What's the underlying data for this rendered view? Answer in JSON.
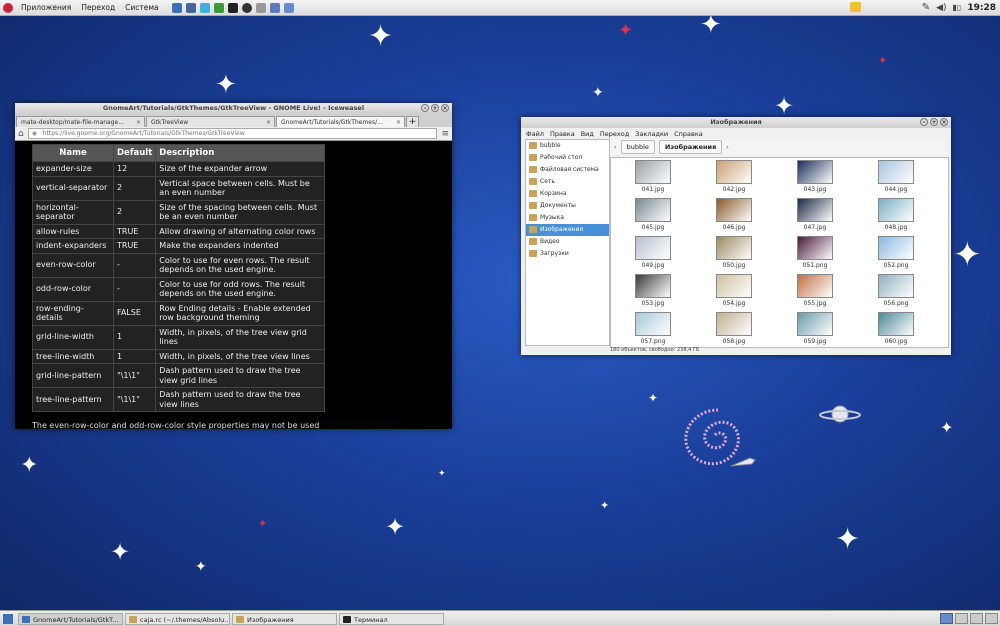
{
  "top_panel": {
    "menus": [
      "Приложения",
      "Переход",
      "Система"
    ],
    "clock": "19:28"
  },
  "browser": {
    "title": "GnomeArt/Tutorials/GtkThemes/GtkTreeView - GNOME Live! - Iceweasel",
    "tabs": [
      {
        "label": "mate-desktop/mate-file-manage..."
      },
      {
        "label": "GtkTreeView"
      },
      {
        "label": "GnomeArt/Tutorials/GtkThemes/..."
      }
    ],
    "url": "https://live.gnome.org/GnomeArt/Tutorials/GtkThemes/GtkTreeView",
    "table": {
      "headers": [
        "Name",
        "Default",
        "Description"
      ],
      "rows": [
        [
          "expander-size",
          "12",
          "Size of the expander arrow"
        ],
        [
          "vertical-separator",
          "2",
          "Vertical space between cells. Must be an even number"
        ],
        [
          "horizontal-separator",
          "2",
          "Size of the spacing between cells. Must be an even number"
        ],
        [
          "allow-rules",
          "TRUE",
          "Allow drawing of alternating color rows"
        ],
        [
          "indent-expanders",
          "TRUE",
          "Make the expanders indented"
        ],
        [
          "even-row-color",
          "-",
          "Color to use for even rows. The result depends on the used engine."
        ],
        [
          "odd-row-color",
          "-",
          "Color to use for odd rows. The result depends on the used engine."
        ],
        [
          "row-ending-details",
          "FALSE",
          "Row Ending details - Enable extended row background theming"
        ],
        [
          "grid-line-width",
          "1",
          "Width, in pixels, of the tree view grid lines"
        ],
        [
          "tree-line-width",
          "1",
          "Width, in pixels, of the tree view lines"
        ],
        [
          "grid-line-pattern",
          "\"\\1\\1\"",
          "Dash pattern used to draw the tree view grid lines"
        ],
        [
          "tree-line-pattern",
          "\"\\1\\1\"",
          "Dash pattern used to draw the tree view lines"
        ]
      ]
    },
    "footer": "The even-row-color and odd-row-color style properties may not be used"
  },
  "file_manager": {
    "title": "Изображения",
    "menus": [
      "Файл",
      "Правка",
      "Вид",
      "Переход",
      "Закладки",
      "Справка"
    ],
    "sidebar": [
      "bubble",
      "Рабочий стол",
      "Файловая система",
      "Сеть",
      "Корзина",
      "Документы",
      "Музыка",
      "Изображения",
      "Видео",
      "Загрузки"
    ],
    "selected_sidebar": "Изображения",
    "breadcrumbs": [
      "bubble",
      "Изображения"
    ],
    "files": [
      "041.jpg",
      "042.jpg",
      "043.jpg",
      "044.jpg",
      "045.jpg",
      "046.jpg",
      "047.jpg",
      "048.jpg",
      "049.jpg",
      "050.jpg",
      "051.png",
      "052.png",
      "053.jpg",
      "054.jpg",
      "055.jpg",
      "056.png",
      "057.png",
      "058.jpg",
      "059.jpg",
      "060.jpg"
    ],
    "status": "180 объектов, свободно: 238,4 ГБ"
  },
  "taskbar": {
    "tasks": [
      "GnomeArt/Tutorials/GtkT...",
      "caja.rc (~/.themes/Absolu...",
      "Изображения",
      "Терминал"
    ]
  }
}
